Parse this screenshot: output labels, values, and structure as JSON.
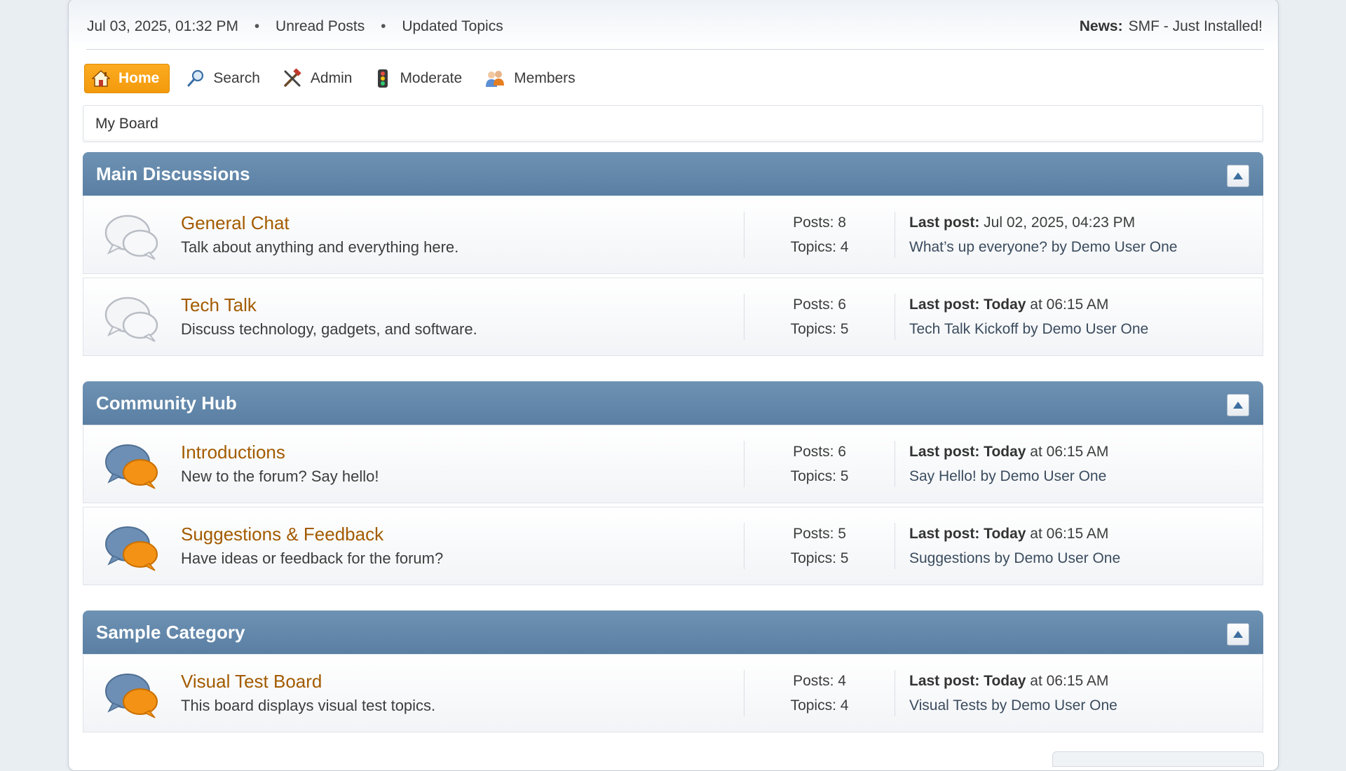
{
  "upper": {
    "datetime": "Jul 03, 2025, 01:32 PM",
    "separator": "•",
    "unread_posts": "Unread Posts",
    "updated_topics": "Updated Topics",
    "news_label": "News:",
    "news_text": "SMF - Just Installed!"
  },
  "menu": {
    "home": "Home",
    "search": "Search",
    "admin": "Admin",
    "moderate": "Moderate",
    "members": "Members"
  },
  "linktree": {
    "board": "My Board"
  },
  "labels": {
    "last_post": "Last post:",
    "today": "Today"
  },
  "categories": [
    {
      "title": "Main Discussions",
      "boards": [
        {
          "name": "General Chat",
          "description": "Talk about anything and everything here.",
          "posts": "Posts: 8",
          "topics": "Topics: 4",
          "last_post_label": "Last post:",
          "last_post_time": " Jul 02, 2025, 04:23 PM",
          "last_post_topic": "What’s up everyone? by Demo User One"
        },
        {
          "name": "Tech Talk",
          "description": "Discuss technology, gadgets, and software.",
          "posts": "Posts: 6",
          "topics": "Topics: 5",
          "last_post_label": "Last post: Today",
          "last_post_time": " at 06:15 AM",
          "last_post_topic": "Tech Talk Kickoff by Demo User One"
        }
      ]
    },
    {
      "title": "Community Hub",
      "boards": [
        {
          "name": "Introductions",
          "description": "New to the forum? Say hello!",
          "posts": "Posts: 6",
          "topics": "Topics: 5",
          "last_post_label": "Last post: Today",
          "last_post_time": " at 06:15 AM",
          "last_post_topic": "Say Hello! by Demo User One"
        },
        {
          "name": "Suggestions & Feedback",
          "description": "Have ideas or feedback for the forum?",
          "posts": "Posts: 5",
          "topics": "Topics: 5",
          "last_post_label": "Last post: Today",
          "last_post_time": " at 06:15 AM",
          "last_post_topic": "Suggestions by Demo User One"
        }
      ]
    },
    {
      "title": "Sample Category",
      "boards": [
        {
          "name": "Visual Test Board",
          "description": "This board displays visual test topics.",
          "posts": "Posts: 4",
          "topics": "Topics: 4",
          "last_post_label": "Last post: Today",
          "last_post_time": " at 06:15 AM",
          "last_post_topic": "Visual Tests by Demo User One"
        }
      ]
    }
  ],
  "colors": {
    "accent_orange": "#f7a11a",
    "category_blue": "#5f84a8",
    "board_link": "#a35b00"
  },
  "icons": [
    "home-icon",
    "search-icon",
    "admin-icon",
    "moderate-icon",
    "members-icon",
    "board-icon-read",
    "board-icon-new",
    "collapse-icon"
  ]
}
